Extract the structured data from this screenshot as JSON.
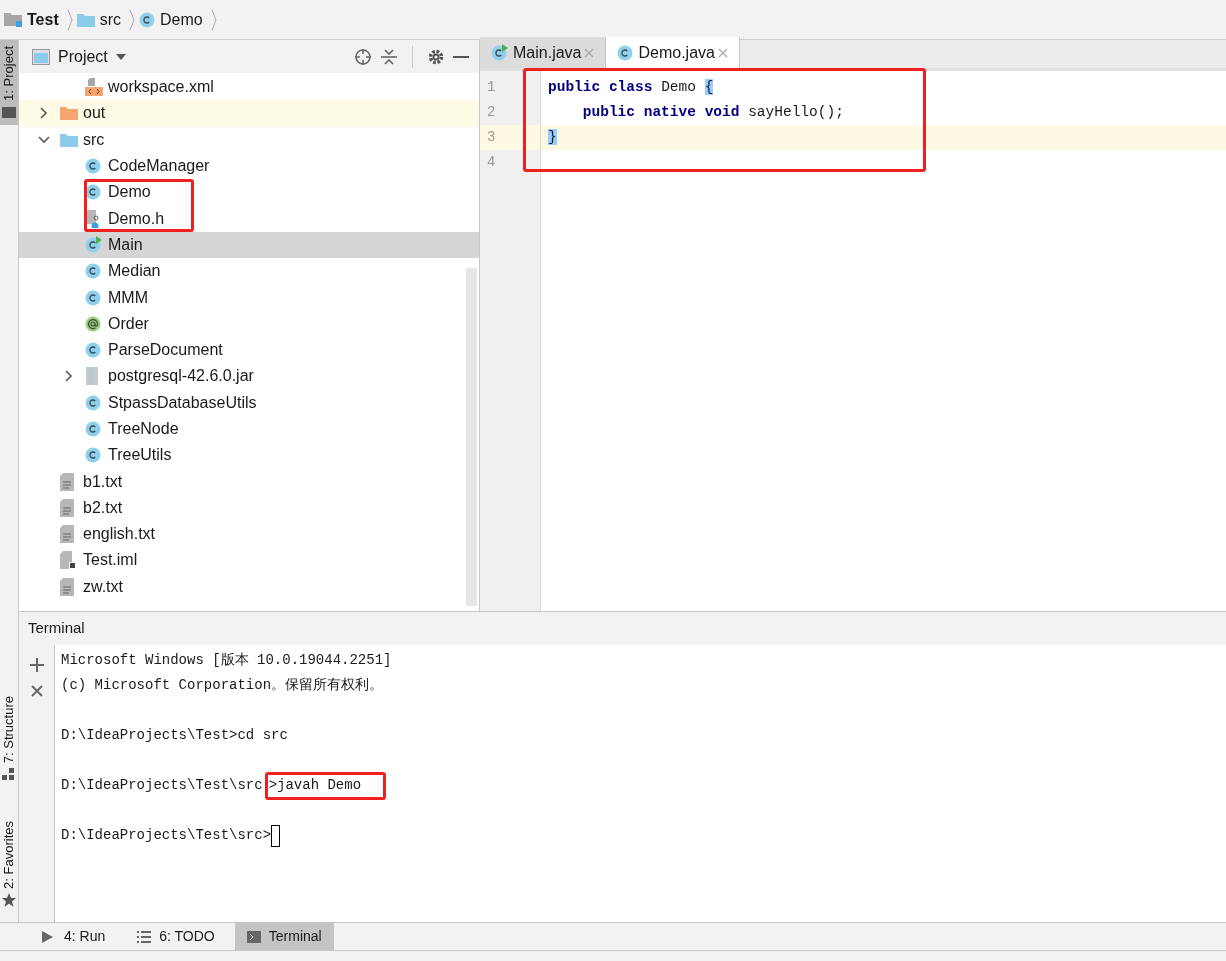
{
  "breadcrumb": [
    {
      "label": "Test",
      "kind": "project"
    },
    {
      "label": "src",
      "kind": "folder"
    },
    {
      "label": "Demo",
      "kind": "class"
    }
  ],
  "side_tabs": [
    {
      "label": "1: Project",
      "selected": true,
      "kind": "project"
    },
    {
      "label": "7: Structure",
      "selected": false,
      "kind": "structure"
    },
    {
      "label": "2: Favorites",
      "selected": false,
      "kind": "favorites"
    }
  ],
  "project_panel": {
    "title": "Project",
    "tree": [
      {
        "children": [
          {
            "label": "workspace.xml",
            "kind": "xml",
            "selected": false,
            "highlighted": false,
            "boxed": false
          }
        ]
      },
      {
        "label": "out",
        "kind": "folder-excluded",
        "expanded": false,
        "selected": false,
        "highlighted": true,
        "boxed": false
      },
      {
        "label": "src",
        "kind": "folder",
        "expanded": true,
        "selected": false,
        "highlighted": false,
        "boxed": false,
        "children": [
          {
            "label": "CodeManager",
            "kind": "class",
            "selected": false,
            "highlighted": false,
            "boxed": false
          },
          {
            "label": "Demo",
            "kind": "class",
            "selected": false,
            "highlighted": false,
            "boxed": true
          },
          {
            "label": "Demo.h",
            "kind": "h-file",
            "selected": false,
            "highlighted": false,
            "boxed": true
          },
          {
            "label": "Main",
            "kind": "class-run",
            "selected": true,
            "highlighted": false,
            "boxed": false
          },
          {
            "label": "Median",
            "kind": "class",
            "selected": false,
            "highlighted": false,
            "boxed": false
          },
          {
            "label": "MMM",
            "kind": "class",
            "selected": false,
            "highlighted": false,
            "boxed": false
          },
          {
            "label": "Order",
            "kind": "annotation",
            "selected": false,
            "highlighted": false,
            "boxed": false
          },
          {
            "label": "ParseDocument",
            "kind": "class",
            "selected": false,
            "highlighted": false,
            "boxed": false
          },
          {
            "label": "postgresql-42.6.0.jar",
            "kind": "jar",
            "expanded": false,
            "selected": false,
            "highlighted": false,
            "boxed": false
          },
          {
            "label": "StpassDatabaseUtils",
            "kind": "class",
            "selected": false,
            "highlighted": false,
            "boxed": false
          },
          {
            "label": "TreeNode",
            "kind": "class",
            "selected": false,
            "highlighted": false,
            "boxed": false
          },
          {
            "label": "TreeUtils",
            "kind": "class",
            "selected": false,
            "highlighted": false,
            "boxed": false
          }
        ]
      },
      {
        "label": "b1.txt",
        "kind": "text-file",
        "selected": false,
        "highlighted": false,
        "boxed": false
      },
      {
        "label": "b2.txt",
        "kind": "text-file",
        "selected": false,
        "highlighted": false,
        "boxed": false
      },
      {
        "label": "english.txt",
        "kind": "text-file",
        "selected": false,
        "highlighted": false,
        "boxed": false
      },
      {
        "label": "Test.iml",
        "kind": "iml",
        "selected": false,
        "highlighted": false,
        "boxed": false
      },
      {
        "label": "zw.txt",
        "kind": "text-file",
        "selected": false,
        "highlighted": false,
        "boxed": false
      }
    ]
  },
  "editor": {
    "tabs": [
      {
        "label": "Main.java",
        "kind": "class-run",
        "selected": false
      },
      {
        "label": "Demo.java",
        "kind": "class",
        "selected": true
      }
    ],
    "boxed": true,
    "lines": [
      {
        "number": "1",
        "current": false,
        "tokens": [
          {
            "text": "public",
            "kind": "keyword"
          },
          {
            "text": " class",
            "kind": "keyword"
          },
          {
            "text": " Demo ",
            "kind": "plain"
          },
          {
            "text": "{",
            "kind": "brace-match"
          }
        ]
      },
      {
        "number": "2",
        "current": false,
        "tokens": [
          {
            "text": "    public",
            "kind": "keyword"
          },
          {
            "text": " native",
            "kind": "keyword"
          },
          {
            "text": " void",
            "kind": "keyword"
          },
          {
            "text": " sayHello();",
            "kind": "plain"
          }
        ]
      },
      {
        "number": "3",
        "current": true,
        "tokens": [
          {
            "text": "}",
            "kind": "brace-match"
          }
        ]
      },
      {
        "number": "4",
        "current": false
      }
    ]
  },
  "terminal": {
    "title": "Terminal",
    "lines": [
      {
        "blank_before": false,
        "parts": [
          {
            "text": "Microsoft Windows [版本 10.0.19044.2251]",
            "boxed": false
          }
        ],
        "cursor": false
      },
      {
        "blank_before": false,
        "parts": [
          {
            "text": "(c) Microsoft Corporation。保留所有权利。",
            "boxed": false
          }
        ],
        "cursor": false
      },
      {
        "blank_before": true,
        "parts": [
          {
            "text": "D:\\IdeaProjects\\Test>cd src",
            "boxed": false
          }
        ],
        "cursor": false
      },
      {
        "blank_before": true,
        "parts": [
          {
            "text": "D:\\IdeaProjects\\Test\\src",
            "boxed": false
          },
          {
            "text": ">javah Demo",
            "boxed": true
          }
        ],
        "cursor": false
      },
      {
        "blank_before": true,
        "parts": [
          {
            "text": "D:\\IdeaProjects\\Test\\src>",
            "boxed": false
          }
        ],
        "cursor": true
      }
    ]
  },
  "bottom_tabs": [
    {
      "label": "4: Run",
      "kind": "run",
      "selected": false
    },
    {
      "label": "6: TODO",
      "kind": "todo",
      "selected": false
    },
    {
      "label": "Terminal",
      "kind": "terminal",
      "selected": true
    }
  ]
}
